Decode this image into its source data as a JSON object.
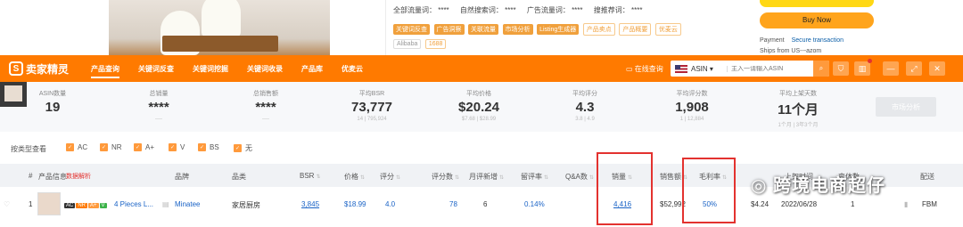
{
  "top": {
    "stats_row": [
      "全部流量词： ****",
      "自然搜索词： ****",
      "广告流量词： ****",
      "搜推荐词： ****"
    ],
    "tags": [
      "关键词反查",
      "广告洞察",
      "关联流量",
      "市场分析",
      "Listing生成器",
      "产品卖点",
      "产品概要",
      "优麦云",
      "Alibaba",
      "1688"
    ],
    "buy_label": "Buy Now",
    "payment_label": "Payment",
    "payment_value": "Secure transaction",
    "ships_label": "Ships from",
    "ships_value": "US---azom"
  },
  "navbar": {
    "logo_text": "卖家精灵",
    "items": [
      "产品查询",
      "关键词反查",
      "关键词挖掘",
      "关键词收录",
      "产品库",
      "优麦云"
    ],
    "history": "在线查询",
    "market": "ASIN",
    "search_placeholder": "主入一请输入ASIN"
  },
  "summary": [
    {
      "label": "ASIN数量",
      "value": "19",
      "sub": ""
    },
    {
      "label": "总销量",
      "value": "****",
      "sub": "----"
    },
    {
      "label": "总销售额",
      "value": "****",
      "sub": "----"
    },
    {
      "label": "平均BSR",
      "value": "73,777",
      "sub": "14 | 795,924"
    },
    {
      "label": "平均价格",
      "value": "$20.24",
      "sub": "$7.68 | $28.99"
    },
    {
      "label": "平均评分",
      "value": "4.3",
      "sub": "3.8 | 4.9"
    },
    {
      "label": "平均评分数",
      "value": "1,908",
      "sub": "1 | 12,884"
    },
    {
      "label": "平均上架天数",
      "value": "11个月",
      "sub": "1个月 | 3年3个月"
    }
  ],
  "market_btn": "市场分析",
  "filters": {
    "title": "按类型查看",
    "options": [
      "AC",
      "NR",
      "A+",
      "V",
      "BS",
      "无"
    ]
  },
  "table": {
    "headers": [
      "#",
      "产品信息",
      "数据解析",
      "品牌",
      "品类",
      "BSR",
      "价格",
      "评分",
      "评分数",
      "月评新增",
      "留评率",
      "Q&A数",
      "销量",
      "销售额",
      "毛利率",
      "上架时间",
      "变体数",
      "配送"
    ],
    "row": {
      "index": "1",
      "badges": [
        "AC",
        "NR",
        "A+",
        "V"
      ],
      "title": "4 Pieces L...",
      "brand": "Minatee",
      "category": "家居厨房",
      "bsr": "3,845",
      "price": "$18.99",
      "rating": "4.0",
      "ratings": "78",
      "monthly_new": "6",
      "review_rate": "0.14%",
      "sales": "4,416",
      "revenue": "$52,992",
      "margin": "50%",
      "fee": "$4.24",
      "date": "2022/06/28",
      "variants": "1",
      "fulfill": "FBM"
    }
  },
  "watermark": "跨境电商超仔"
}
